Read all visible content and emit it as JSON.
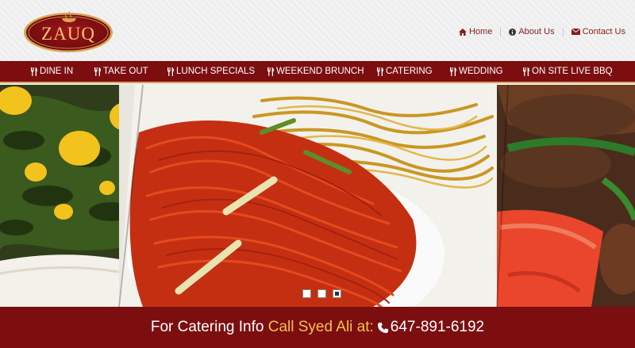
{
  "brand": {
    "logo_text": "ZAUQ"
  },
  "top_links": [
    {
      "label": "Home",
      "icon": "home-icon"
    },
    {
      "label": "About Us",
      "icon": "info-icon"
    },
    {
      "label": "Contact Us",
      "icon": "envelope-icon"
    }
  ],
  "nav": {
    "items": [
      {
        "label": "DINE IN"
      },
      {
        "label": "TAKE OUT"
      },
      {
        "label": "LUNCH SPECIALS"
      },
      {
        "label": "WEEKEND BRUNCH"
      },
      {
        "label": "CATERING"
      },
      {
        "label": "WEDDING"
      },
      {
        "label": "ON SITE LIVE BBQ"
      }
    ],
    "icon": "cutlery-icon"
  },
  "slider": {
    "slide_count": 3,
    "active_index": 2
  },
  "catering_bar": {
    "prefix": "For Catering Info",
    "call": "Call Syed Ali at:",
    "phone": "647-891-6192",
    "icon": "phone-icon"
  },
  "colors": {
    "brand_red": "#7c0e10",
    "gold": "#f2c14e",
    "accent_border": "#d9a05b"
  }
}
